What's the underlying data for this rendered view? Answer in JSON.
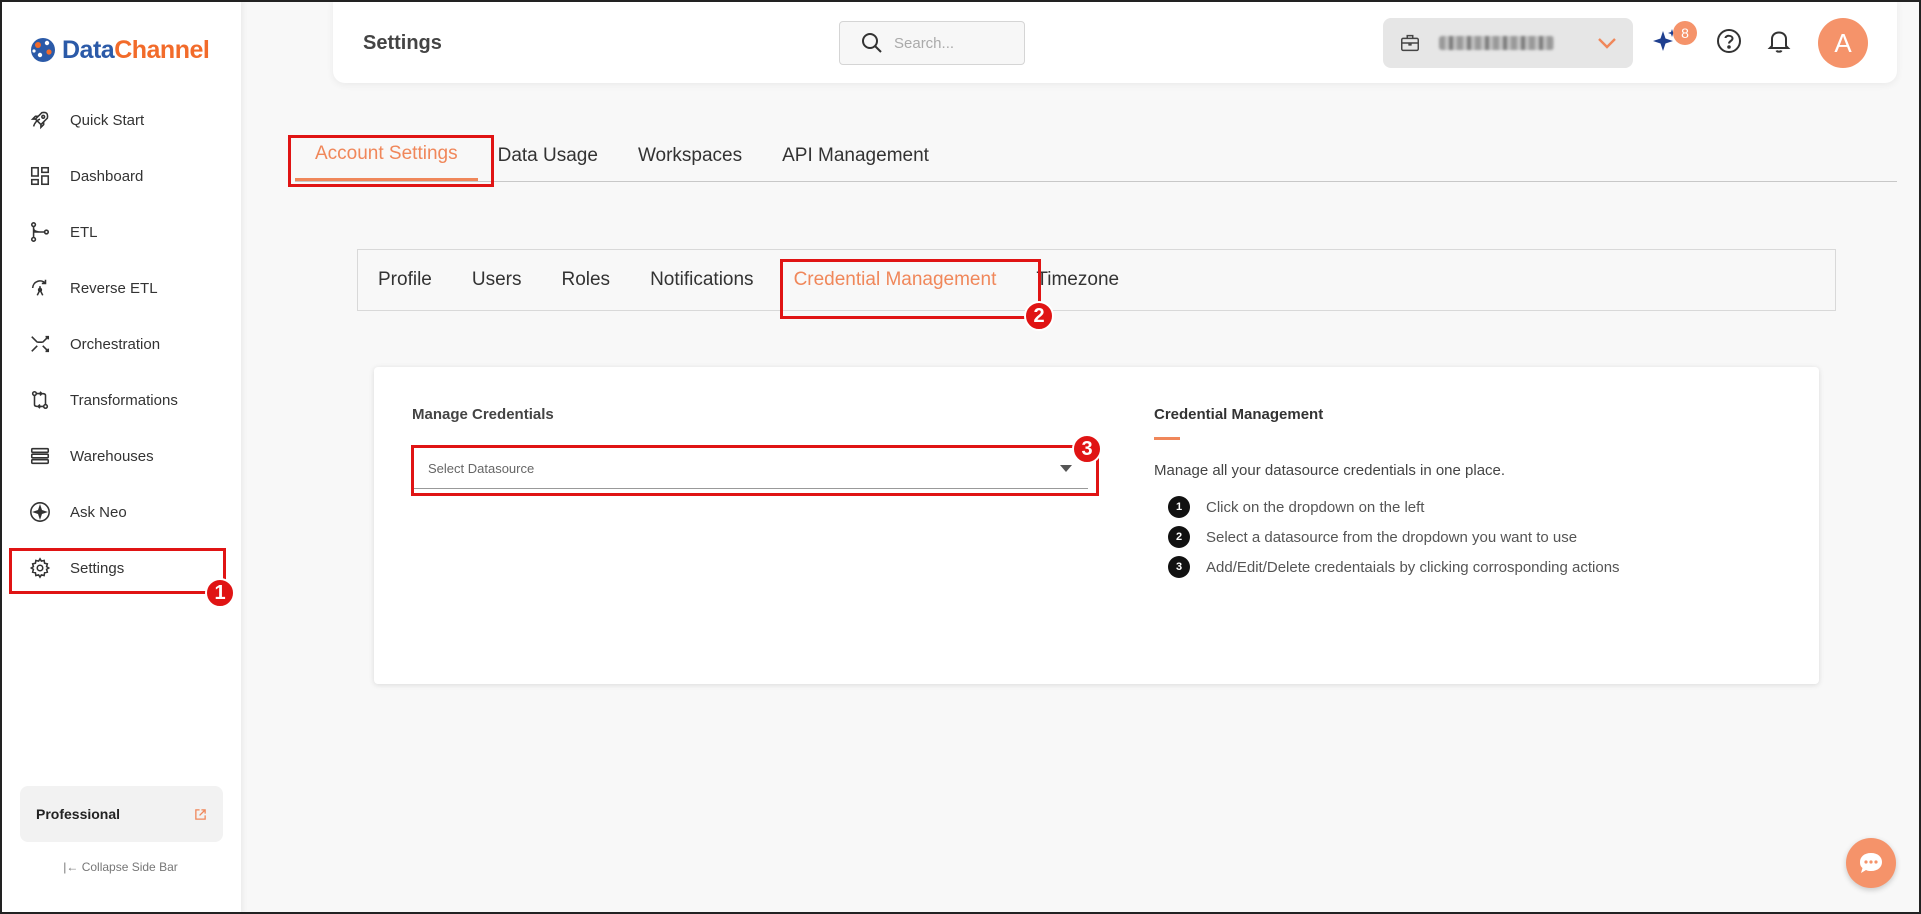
{
  "brand": {
    "name_part1": "Data",
    "name_part2": "Channel",
    "color_primary": "#2b5aa8",
    "color_accent": "#f26b2a"
  },
  "sidebar": {
    "items": [
      {
        "label": "Quick Start",
        "icon": "rocket-icon"
      },
      {
        "label": "Dashboard",
        "icon": "dashboard-grid-icon"
      },
      {
        "label": "ETL",
        "icon": "etl-flow-icon"
      },
      {
        "label": "Reverse ETL",
        "icon": "reverse-etl-icon"
      },
      {
        "label": "Orchestration",
        "icon": "orchestration-icon"
      },
      {
        "label": "Transformations",
        "icon": "transformations-icon"
      },
      {
        "label": "Warehouses",
        "icon": "warehouse-stack-icon"
      },
      {
        "label": "Ask Neo",
        "icon": "sparkle-icon"
      },
      {
        "label": "Settings",
        "icon": "gear-icon"
      }
    ],
    "plan_label": "Professional",
    "collapse_label": "Collapse Side Bar"
  },
  "header": {
    "title": "Settings",
    "search_placeholder": "Search...",
    "notification_count": "8",
    "avatar_initial": "A"
  },
  "tabs_primary": [
    "Account Settings",
    "Data Usage",
    "Workspaces",
    "API Management"
  ],
  "tabs_secondary": [
    "Profile",
    "Users",
    "Roles",
    "Notifications",
    "Credential Management",
    "Timezone"
  ],
  "card": {
    "manage_label": "Manage Credentials",
    "select_placeholder": "Select Datasource",
    "help_title": "Credential Management",
    "help_desc": "Manage all your datasource credentials in one place.",
    "steps": [
      {
        "num": "1",
        "text": "Click on the dropdown on the left"
      },
      {
        "num": "2",
        "text": "Select a datasource from the dropdown you want to use"
      },
      {
        "num": "3",
        "text": "Add/Edit/Delete credentaials by clicking corrosponding actions"
      }
    ]
  },
  "annotations": [
    "1",
    "2",
    "3"
  ],
  "colors": {
    "accent": "#f0875a",
    "highlight": "#e01414"
  }
}
